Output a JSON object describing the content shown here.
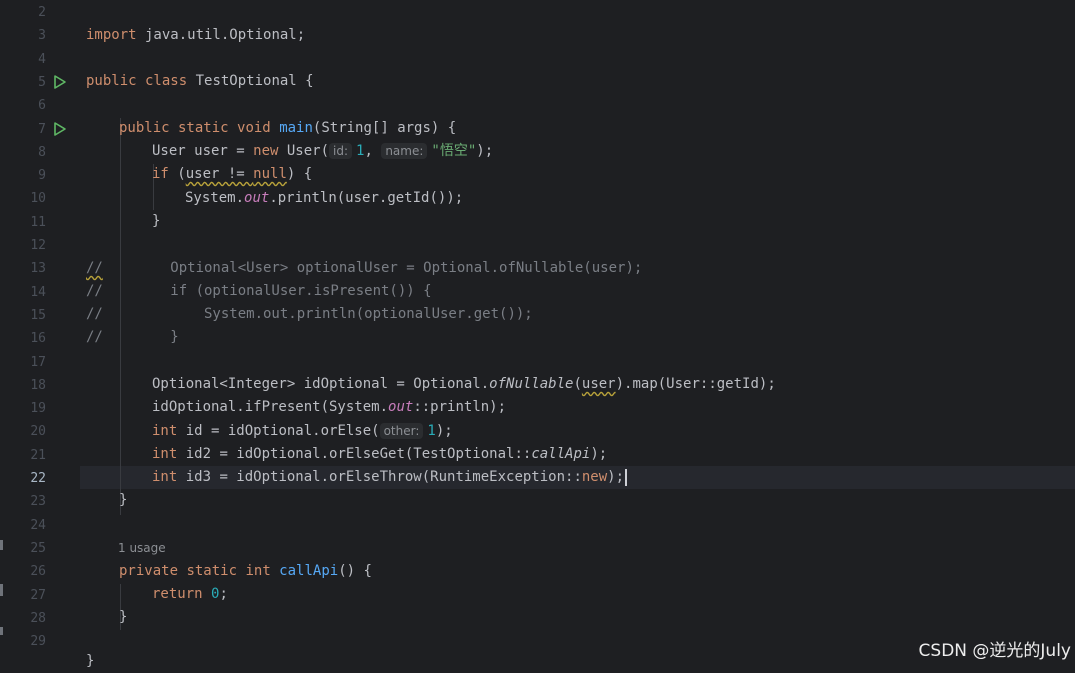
{
  "gutter": {
    "line_numbers": [
      "2",
      "3",
      "4",
      "5",
      "6",
      "7",
      "8",
      "9",
      "10",
      "11",
      "12",
      "13",
      "14",
      "15",
      "16",
      "17",
      "18",
      "19",
      "20",
      "21",
      "22",
      "23",
      "24",
      "25",
      "26",
      "27",
      "28",
      "29"
    ],
    "current_line": "22",
    "run_icons": "run-icon",
    "bulb_icon": "lightbulb-icon"
  },
  "code": {
    "l3": {
      "k": "import",
      "t": " java.util.Optional;"
    },
    "l5": {
      "k1": "public",
      "k2": " class",
      "t": " TestOptional {"
    },
    "l7": {
      "k1": "public",
      "k2": " static",
      "k3": " void",
      "fn": "main",
      "t": "(String[] args) {"
    },
    "l8": {
      "a": "User user = ",
      "k": "new",
      "b": " User(",
      "h1": "id:",
      "n": "1",
      "c": ", ",
      "h2": "name:",
      "s": "\"悟空\"",
      "d": ");"
    },
    "l9": {
      "k1": "if",
      "a": " (",
      "u": "user != ",
      "k2": "null",
      "b": ") {"
    },
    "l10": {
      "a": "System.",
      "st": "out",
      "b": ".println(user.getId());"
    },
    "l11": {
      "t": "}"
    },
    "l13": {
      "c": "//",
      "t": "        Optional<User> optionalUser = Optional.ofNullable(user);"
    },
    "l14": {
      "c": "//",
      "t": "        if (optionalUser.isPresent()) {"
    },
    "l15": {
      "c": "//",
      "t": "            System.out.println(optionalUser.get());"
    },
    "l16": {
      "c": "//",
      "t": "        }"
    },
    "l18": {
      "a": "Optional<Integer> idOptional = Optional.",
      "sm": "ofNullable",
      "b": "(",
      "u": "user",
      "c": ").map(User::getId);"
    },
    "l19": {
      "a": "idOptional.ifPresent(System.",
      "st": "out",
      "b": "::println);"
    },
    "l20": {
      "k": "int",
      "a": " id = idOptional.orElse(",
      "h": "other:",
      "n": "1",
      "b": ");"
    },
    "l21": {
      "k": "int",
      "a": " id2 = idOptional.orElseGet(TestOptional::",
      "sm": "callApi",
      "b": ");"
    },
    "l22": {
      "k1": "int",
      "a": " id3 = idOptional.orElseThrow(RuntimeException::",
      "k2": "new",
      "b": ");"
    },
    "l23": {
      "t": "}"
    },
    "usage": "1 usage",
    "l25": {
      "k1": "private",
      "k2": " static",
      "k3": " int",
      "fn": " callApi",
      "t": "() {"
    },
    "l26": {
      "k": "return",
      "a": " ",
      "n": "0",
      "b": ";"
    },
    "l27": {
      "t": "}"
    },
    "l29": {
      "t": "}"
    }
  },
  "watermark": "CSDN @逆光的July",
  "colors": {
    "background": "#1e1f22",
    "keyword": "#cf8e6d",
    "function": "#56a8f5",
    "static_field": "#c77dbb",
    "number": "#2aacb8",
    "string": "#6aab73",
    "comment": "#7a7e85"
  }
}
